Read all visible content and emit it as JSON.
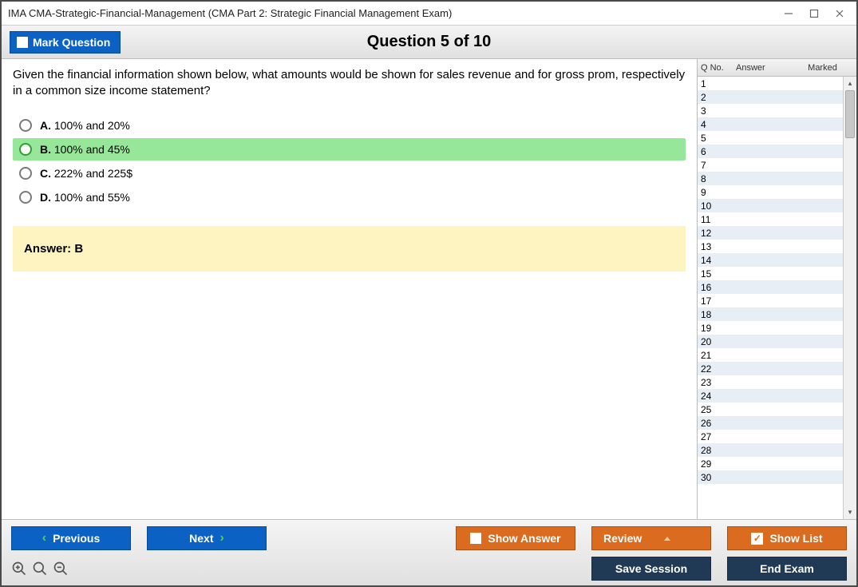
{
  "window": {
    "title": "IMA CMA-Strategic-Financial-Management (CMA Part 2: Strategic Financial Management Exam)"
  },
  "header": {
    "mark_label": "Mark Question",
    "counter": "Question 5 of 10"
  },
  "question": {
    "text": "Given the financial information shown below, what amounts would be shown for sales revenue and for gross prom, respectively in a common size income statement?",
    "options": [
      {
        "letter": "A.",
        "text": "100% and 20%",
        "selected": false
      },
      {
        "letter": "B.",
        "text": "100% and 45%",
        "selected": true
      },
      {
        "letter": "C.",
        "text": "222% and 225$",
        "selected": false
      },
      {
        "letter": "D.",
        "text": "100% and 55%",
        "selected": false
      }
    ],
    "answer_label": "Answer: B"
  },
  "side": {
    "col_qno": "Q No.",
    "col_answer": "Answer",
    "col_marked": "Marked",
    "rows": [
      {
        "n": "1"
      },
      {
        "n": "2"
      },
      {
        "n": "3"
      },
      {
        "n": "4"
      },
      {
        "n": "5"
      },
      {
        "n": "6"
      },
      {
        "n": "7"
      },
      {
        "n": "8"
      },
      {
        "n": "9"
      },
      {
        "n": "10"
      },
      {
        "n": "11"
      },
      {
        "n": "12"
      },
      {
        "n": "13"
      },
      {
        "n": "14"
      },
      {
        "n": "15"
      },
      {
        "n": "16"
      },
      {
        "n": "17"
      },
      {
        "n": "18"
      },
      {
        "n": "19"
      },
      {
        "n": "20"
      },
      {
        "n": "21"
      },
      {
        "n": "22"
      },
      {
        "n": "23"
      },
      {
        "n": "24"
      },
      {
        "n": "25"
      },
      {
        "n": "26"
      },
      {
        "n": "27"
      },
      {
        "n": "28"
      },
      {
        "n": "29"
      },
      {
        "n": "30"
      }
    ]
  },
  "buttons": {
    "previous": "Previous",
    "next": "Next",
    "show_answer": "Show Answer",
    "review": "Review",
    "show_list": "Show List",
    "save_session": "Save Session",
    "end_exam": "End Exam"
  }
}
